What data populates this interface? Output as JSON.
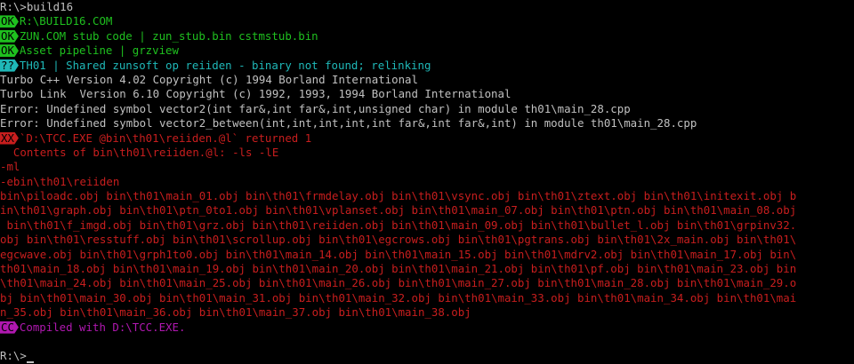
{
  "prompt_line": {
    "prompt": "R:\\>",
    "command": "build16"
  },
  "steps": [
    {
      "tag": "OK",
      "text": "R:\\BUILD16.COM"
    },
    {
      "tag": "OK",
      "text": "ZUN.COM stub code | zun_stub.bin cstmstub.bin"
    },
    {
      "tag": "OK",
      "text": "Asset pipeline | grzview"
    },
    {
      "tag": "??",
      "text": "TH01 | Shared zunsoft op reiiden - binary not found; relinking"
    }
  ],
  "compiler_output": [
    "Turbo C++ Version 4.02 Copyright (c) 1994 Borland International",
    "Turbo Link  Version 6.10 Copyright (c) 1992, 1993, 1994 Borland International",
    "Error: Undefined symbol vector2(int far&,int far&,int,unsigned char) in module th01\\main_28.cpp",
    "Error: Undefined symbol vector2_between(int,int,int,int,int far&,int far&,int) in module th01\\main_28.cpp"
  ],
  "failure": {
    "tag": "XX",
    "text": "`D:\\TCC.EXE @bin\\th01\\reiiden.@l` returned 1"
  },
  "response_file": {
    "heading": "  Contents of bin\\th01\\reiiden.@l: -ls -lE",
    "lines": [
      "-ml",
      "-ebin\\th01\\reiiden",
      "bin\\piloadc.obj bin\\th01\\main_01.obj bin\\th01\\frmdelay.obj bin\\th01\\vsync.obj bin\\th01\\ztext.obj bin\\th01\\initexit.obj b",
      "in\\th01\\graph.obj bin\\th01\\ptn_0to1.obj bin\\th01\\vplanset.obj bin\\th01\\main_07.obj bin\\th01\\ptn.obj bin\\th01\\main_08.obj",
      " bin\\th01\\f_imgd.obj bin\\th01\\grz.obj bin\\th01\\reiiden.obj bin\\th01\\main_09.obj bin\\th01\\bullet_l.obj bin\\th01\\grpinv32.",
      "obj bin\\th01\\resstuff.obj bin\\th01\\scrollup.obj bin\\th01\\egcrows.obj bin\\th01\\pgtrans.obj bin\\th01\\2x_main.obj bin\\th01\\",
      "egcwave.obj bin\\th01\\grph1to0.obj bin\\th01\\main_14.obj bin\\th01\\main_15.obj bin\\th01\\mdrv2.obj bin\\th01\\main_17.obj bin\\",
      "th01\\main_18.obj bin\\th01\\main_19.obj bin\\th01\\main_20.obj bin\\th01\\main_21.obj bin\\th01\\pf.obj bin\\th01\\main_23.obj bin",
      "\\th01\\main_24.obj bin\\th01\\main_25.obj bin\\th01\\main_26.obj bin\\th01\\main_27.obj bin\\th01\\main_28.obj bin\\th01\\main_29.o",
      "bj bin\\th01\\main_30.obj bin\\th01\\main_31.obj bin\\th01\\main_32.obj bin\\th01\\main_33.obj bin\\th01\\main_34.obj bin\\th01\\mai",
      "n_35.obj bin\\th01\\main_36.obj bin\\th01\\main_37.obj bin\\th01\\main_38.obj"
    ]
  },
  "compiled": {
    "tag": "CC",
    "text": "Compiled with D:\\TCC.EXE."
  },
  "final_prompt": {
    "prompt": "R:\\>"
  },
  "colors": {
    "background": "#000000",
    "default_text": "#c0c0c0",
    "ok": "#1fc01f",
    "unknown": "#1fb8b8",
    "error": "#c81e1e",
    "compiled": "#b018b0"
  }
}
